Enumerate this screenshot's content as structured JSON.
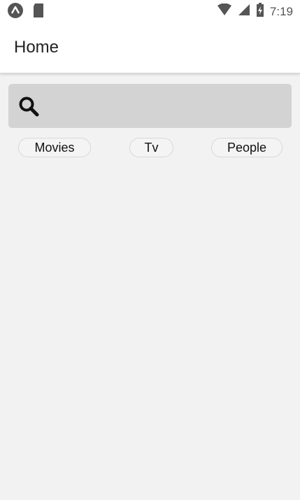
{
  "status_bar": {
    "time": "7:19",
    "icons": [
      "app-logo-icon",
      "sd-card-icon",
      "wifi-icon",
      "cell-signal-icon",
      "battery-charging-icon"
    ]
  },
  "app_bar": {
    "title": "Home"
  },
  "search": {
    "icon": "search-icon",
    "value": "",
    "placeholder": ""
  },
  "filters": [
    {
      "label": "Movies"
    },
    {
      "label": "Tv"
    },
    {
      "label": "People"
    }
  ],
  "colors": {
    "background": "#f2f2f2",
    "search_bg": "#d3d3d3",
    "chip_border": "#d8d8d8"
  }
}
